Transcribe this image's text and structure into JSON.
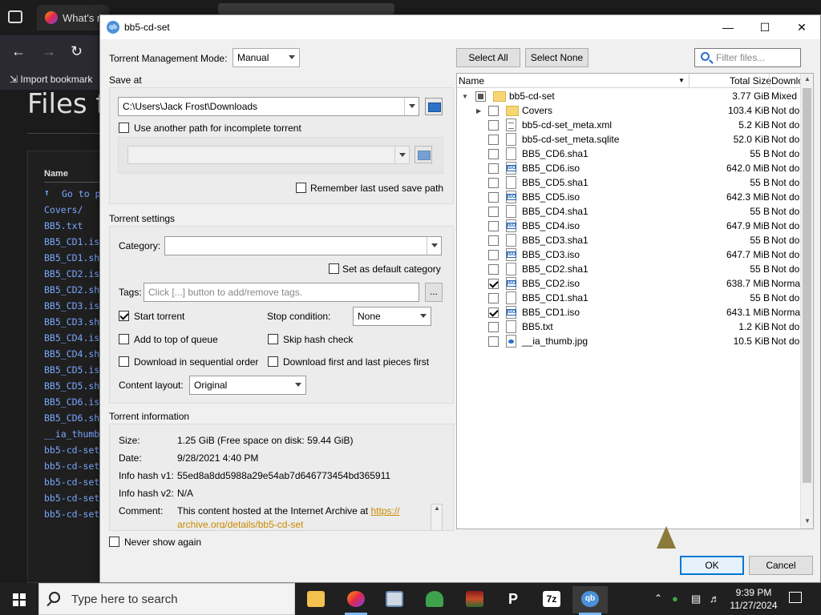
{
  "browser": {
    "tab_title": "What's n",
    "import_bookmarks": "Import bookmark",
    "page_heading": "Files f",
    "list_header": "Name",
    "list_items": [
      "Go to p",
      "Covers/",
      "BB5.txt",
      "BB5_CD1.is",
      "BB5_CD1.sh",
      "BB5_CD2.is",
      "BB5_CD2.sh",
      "BB5_CD3.is",
      "BB5_CD3.sh",
      "BB5_CD4.is",
      "BB5_CD4.sh",
      "BB5_CD5.is",
      "BB5_CD5.sh",
      "BB5_CD6.is",
      "BB5_CD6.sh",
      "__ia_thumb",
      "bb5-cd-set",
      "bb5-cd-set",
      "bb5-cd-set",
      "bb5-cd-set",
      "bb5-cd-set"
    ]
  },
  "dialog": {
    "title": "bb5-cd-set",
    "management_mode_label": "Torrent Management Mode:",
    "management_mode_value": "Manual",
    "save_at_label": "Save at",
    "save_path": "C:\\Users\\Jack Frost\\Downloads",
    "use_another_path": "Use another path for incomplete torrent",
    "remember_path": "Remember last used save path",
    "torrent_settings_label": "Torrent settings",
    "category_label": "Category:",
    "category_value": "",
    "default_category": "Set as default category",
    "tags_label": "Tags:",
    "tags_placeholder": "Click [...] button to add/remove tags.",
    "tags_button": "...",
    "start_torrent": "Start torrent",
    "stop_condition_label": "Stop condition:",
    "stop_condition_value": "None",
    "add_top_queue": "Add to top of queue",
    "skip_hash": "Skip hash check",
    "sequential": "Download in sequential order",
    "first_last": "Download first and last pieces first",
    "content_layout_label": "Content layout:",
    "content_layout_value": "Original",
    "torrent_info_label": "Torrent information",
    "info": {
      "size_label": "Size:",
      "size_value": "1.25 GiB (Free space on disk: 59.44 GiB)",
      "date_label": "Date:",
      "date_value": "9/28/2021 4:40 PM",
      "hash1_label": "Info hash v1:",
      "hash1_value": "55ed8a8dd5988a29e54ab7d646773454bd365911",
      "hash2_label": "Info hash v2:",
      "hash2_value": "N/A",
      "comment_label": "Comment:",
      "comment_value": "This content hosted at the Internet Archive at ",
      "comment_link1": "https://",
      "comment_link2": "archive.org/details/bb5-cd-set"
    },
    "never_show": "Never show again",
    "select_all": "Select All",
    "select_none": "Select None",
    "filter_placeholder": "Filter files...",
    "col_name": "Name",
    "col_size": "Total Size",
    "col_download": "Downlo",
    "ok": "OK",
    "cancel": "Cancel",
    "files": [
      {
        "name": "bb5-cd-set",
        "size": "3.77 GiB",
        "dl": "Mixed"
      },
      {
        "name": "Covers",
        "size": "103.4 KiB",
        "dl": "Not do"
      },
      {
        "name": "bb5-cd-set_meta.xml",
        "size": "5.2 KiB",
        "dl": "Not do"
      },
      {
        "name": "bb5-cd-set_meta.sqlite",
        "size": "52.0 KiB",
        "dl": "Not do"
      },
      {
        "name": "BB5_CD6.sha1",
        "size": "55 B",
        "dl": "Not do"
      },
      {
        "name": "BB5_CD6.iso",
        "size": "642.0 MiB",
        "dl": "Not do"
      },
      {
        "name": "BB5_CD5.sha1",
        "size": "55 B",
        "dl": "Not do"
      },
      {
        "name": "BB5_CD5.iso",
        "size": "642.3 MiB",
        "dl": "Not do"
      },
      {
        "name": "BB5_CD4.sha1",
        "size": "55 B",
        "dl": "Not do"
      },
      {
        "name": "BB5_CD4.iso",
        "size": "647.9 MiB",
        "dl": "Not do"
      },
      {
        "name": "BB5_CD3.sha1",
        "size": "55 B",
        "dl": "Not do"
      },
      {
        "name": "BB5_CD3.iso",
        "size": "647.7 MiB",
        "dl": "Not do"
      },
      {
        "name": "BB5_CD2.sha1",
        "size": "55 B",
        "dl": "Not do"
      },
      {
        "name": "BB5_CD2.iso",
        "size": "638.7 MiB",
        "dl": "Norma"
      },
      {
        "name": "BB5_CD1.sha1",
        "size": "55 B",
        "dl": "Not do"
      },
      {
        "name": "BB5_CD1.iso",
        "size": "643.1 MiB",
        "dl": "Norma"
      },
      {
        "name": "BB5.txt",
        "size": "1.2 KiB",
        "dl": "Not do"
      },
      {
        "name": "__ia_thumb.jpg",
        "size": "10.5 KiB",
        "dl": "Not do"
      }
    ]
  },
  "taskbar": {
    "search_placeholder": "Type here to search",
    "time": "9:39 PM",
    "date": "11/27/2024",
    "app_7z": "7z",
    "app_qb": "qb"
  }
}
